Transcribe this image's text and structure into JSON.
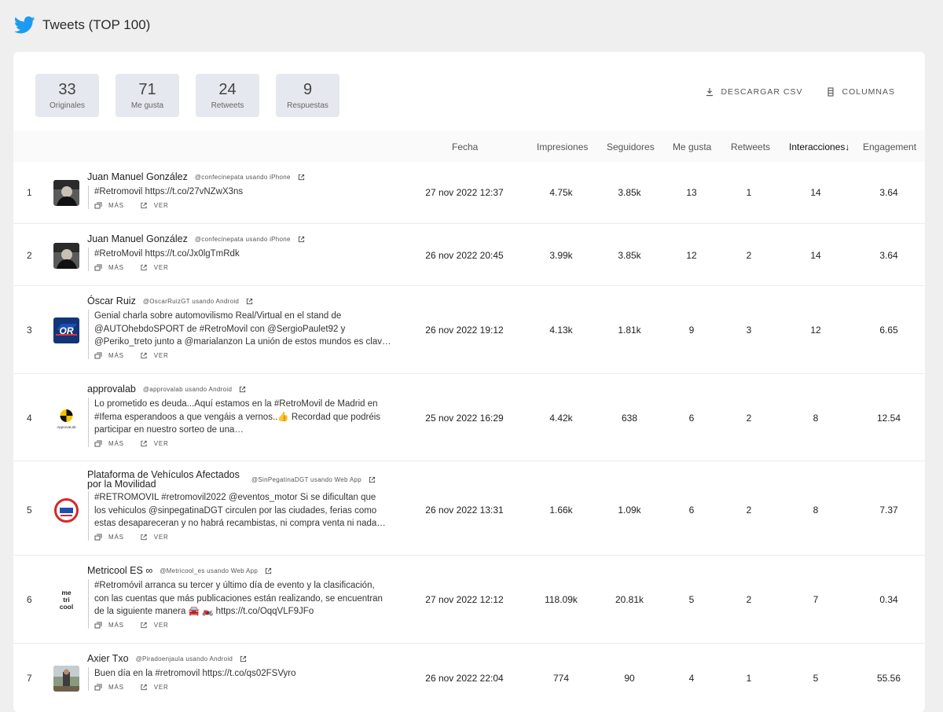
{
  "header": {
    "title": "Tweets (TOP 100)",
    "brand_color": "#1d9bf0"
  },
  "stats": [
    {
      "value": "33",
      "label": "Originales"
    },
    {
      "value": "71",
      "label": "Me gusta"
    },
    {
      "value": "24",
      "label": "Retweets"
    },
    {
      "value": "9",
      "label": "Respuestas"
    }
  ],
  "actions": {
    "download": "DESCARGAR CSV",
    "columns": "COLUMNAS"
  },
  "columns": {
    "fecha": "Fecha",
    "impresiones": "Impresiones",
    "seguidores": "Seguidores",
    "me_gusta": "Me gusta",
    "retweets": "Retweets",
    "interacciones": "Interacciones",
    "sort_indicator": "↓",
    "engagement": "Engagement"
  },
  "row_actions": {
    "more": "MÁS",
    "view": "VER"
  },
  "rows": [
    {
      "idx": "1",
      "name": "Juan Manuel González",
      "handle": "@confecinepata usando iPhone",
      "text": [
        "#Retromovil https://t.co/27vNZwX3ns"
      ],
      "date": "27 nov 2022 12:37",
      "impressions": "4.75k",
      "followers": "3.85k",
      "likes": "13",
      "retweets": "1",
      "interactions": "14",
      "engagement": "3.64",
      "avatar": "photo-dark"
    },
    {
      "idx": "2",
      "name": "Juan Manuel González",
      "handle": "@confecinepata usando iPhone",
      "text": [
        "#RetroMovil https://t.co/Jx0lgTmRdk"
      ],
      "date": "26 nov 2022 20:45",
      "impressions": "3.99k",
      "followers": "3.85k",
      "likes": "12",
      "retweets": "2",
      "interactions": "14",
      "engagement": "3.64",
      "avatar": "photo-dark"
    },
    {
      "idx": "3",
      "name": "Óscar Ruiz",
      "handle": "@OscarRuizGT usando Android",
      "text": [
        "Genial charla sobre automovilismo Real/Virtual en el stand de",
        "@AUTOhebdoSPORT de #RetroMovil con @SergioPaulet92 y",
        "@Periko_treto junto a @marialanzon La unión de estos mundos es clav…"
      ],
      "date": "26 nov 2022 19:12",
      "impressions": "4.13k",
      "followers": "1.81k",
      "likes": "9",
      "retweets": "3",
      "interactions": "12",
      "engagement": "6.65",
      "avatar": "or-logo",
      "avatar_text": "OR"
    },
    {
      "idx": "4",
      "name": "approvalab",
      "handle": "@approvalab usando Android",
      "text": [
        "Lo prometido es deuda...Aquí estamos en la #RetroMovil de Madrid en",
        "#Ifema esperandoos a que vengáis a vernos..👍 Recordad que podréis",
        "participar en nuestro sorteo de una…"
      ],
      "date": "25 nov 2022 16:29",
      "impressions": "4.42k",
      "followers": "638",
      "likes": "6",
      "retweets": "2",
      "interactions": "8",
      "engagement": "12.54",
      "avatar": "approva-logo",
      "avatar_text": "ApprovaLab"
    },
    {
      "idx": "5",
      "name": "Plataforma de Vehículos Afectados por la Movilidad",
      "handle": "@SinPegatinaDGT usando Web App",
      "text": [
        "#RETROMOVIL #retromovil2022 @eventos_motor Si se dificultan que",
        "los vehiculos @sinpegatinaDGT circulen por las ciudades, ferias como",
        "estas desapareceran y no habrá recambistas, ni compra venta ni nada…"
      ],
      "date": "26 nov 2022 13:31",
      "impressions": "1.66k",
      "followers": "1.09k",
      "likes": "6",
      "retweets": "2",
      "interactions": "8",
      "engagement": "7.37",
      "avatar": "badge-logo"
    },
    {
      "idx": "6",
      "name": "Metricool ES ∞",
      "handle": "@Metricool_es usando Web App",
      "text": [
        "#Retromóvil arranca su tercer y último día de evento y la clasificación,",
        "con las cuentas que más publicaciones están realizando, se encuentran",
        "de la siguiente manera 🚘 🏍️ https://t.co/OqqVLF9JFo"
      ],
      "date": "27 nov 2022 12:12",
      "impressions": "118.09k",
      "followers": "20.81k",
      "likes": "5",
      "retweets": "2",
      "interactions": "7",
      "engagement": "0.34",
      "avatar": "metricool-logo",
      "avatar_text": "me tri cool"
    },
    {
      "idx": "7",
      "name": "Axier Txo",
      "handle": "@Piradoenjaula usando Android",
      "text": [
        "Buen día en la #retromovil https://t.co/qs02FSVyro"
      ],
      "date": "26 nov 2022 22:04",
      "impressions": "774",
      "followers": "90",
      "likes": "4",
      "retweets": "1",
      "interactions": "5",
      "engagement": "55.56",
      "avatar": "photo-outdoor"
    }
  ]
}
